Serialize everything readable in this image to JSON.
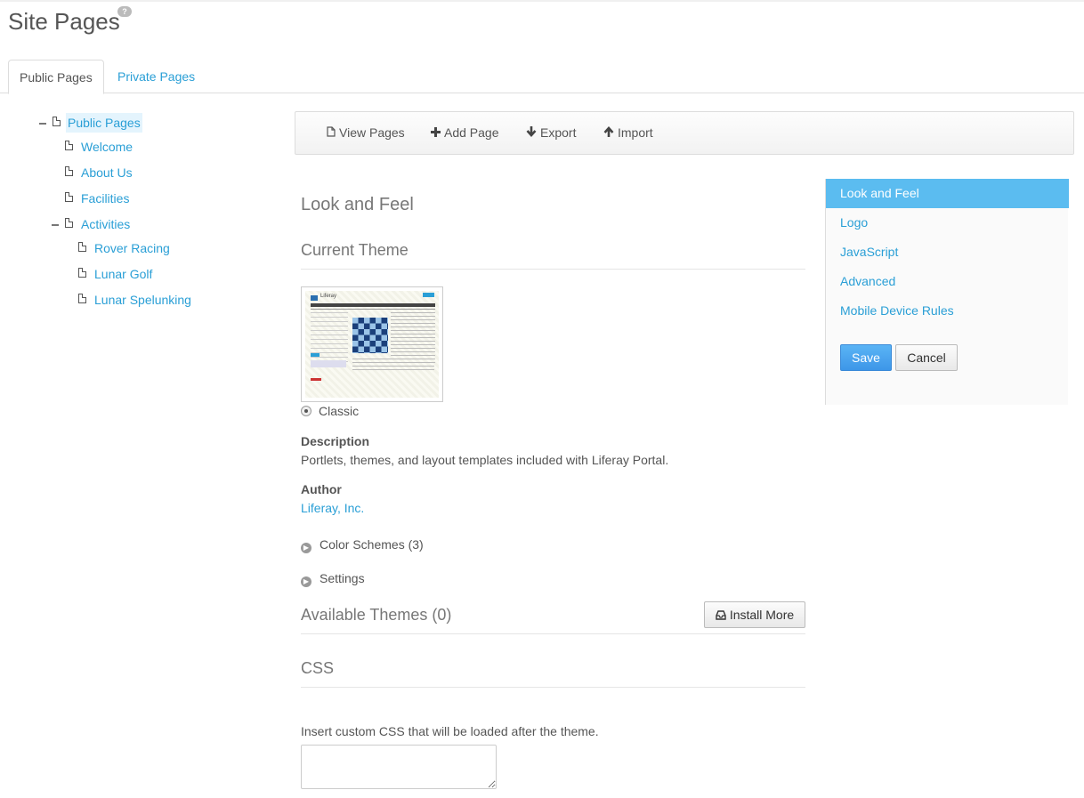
{
  "header": {
    "title": "Site Pages",
    "help_icon": "?"
  },
  "tabs": [
    {
      "label": "Public Pages",
      "active": true
    },
    {
      "label": "Private Pages",
      "active": false
    }
  ],
  "tree": {
    "root": "Public Pages",
    "items": [
      "Welcome",
      "About Us",
      "Facilities",
      "Activities"
    ],
    "activities_children": [
      "Rover Racing",
      "Lunar Golf",
      "Lunar Spelunking"
    ]
  },
  "toolbar": {
    "view_pages": "View Pages",
    "add_page": "Add Page",
    "export": "Export",
    "import": "Import"
  },
  "main": {
    "heading": "Look and Feel",
    "current_theme_heading": "Current Theme",
    "theme_name": "Classic",
    "description_label": "Description",
    "description_text": "Portlets, themes, and layout templates included with Liferay Portal.",
    "author_label": "Author",
    "author_name": "Liferay, Inc.",
    "color_schemes": "Color Schemes (3)",
    "settings": "Settings",
    "available_themes": "Available Themes (0)",
    "install_more": "Install More",
    "css_heading": "CSS",
    "css_help": "Insert custom CSS that will be loaded after the theme.",
    "css_value": ""
  },
  "thumbnail": {
    "logo_text": "Liferay"
  },
  "right_nav": {
    "items": [
      "Look and Feel",
      "Logo",
      "JavaScript",
      "Advanced",
      "Mobile Device Rules"
    ],
    "save": "Save",
    "cancel": "Cancel"
  },
  "colors": {
    "accent": "#2a9fd6",
    "nav_active": "#5bbcf0",
    "primary_button": "#3d96e8"
  }
}
